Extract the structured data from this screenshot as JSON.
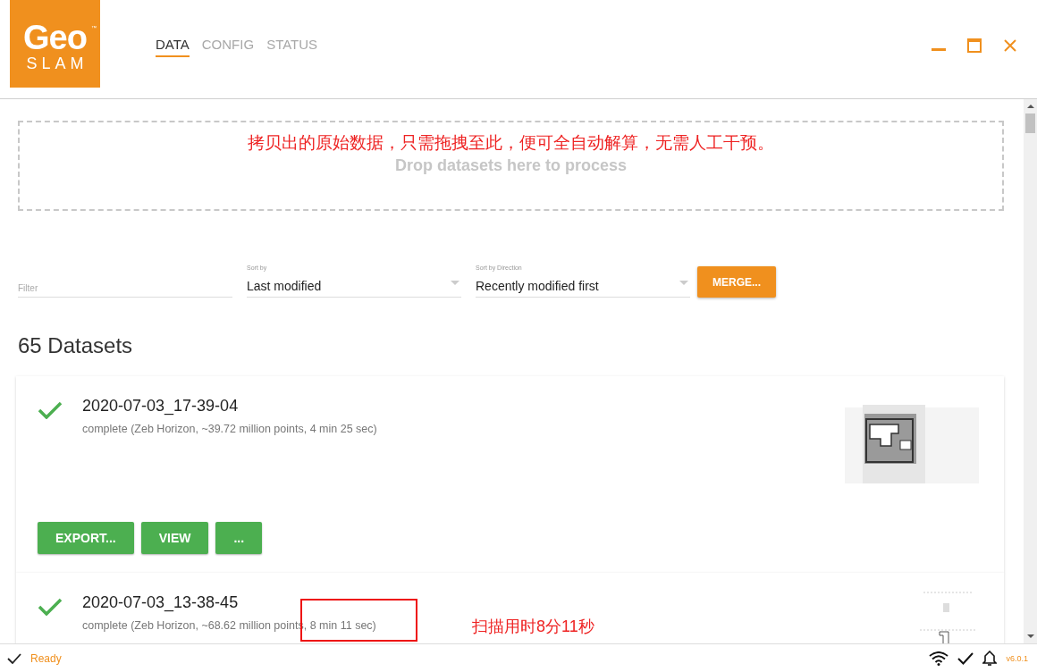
{
  "logo": {
    "word": "Geo",
    "subword": "SLAM",
    "trademark": "™"
  },
  "tabs": [
    {
      "label": "DATA",
      "selected": true
    },
    {
      "label": "CONFIG",
      "selected": false
    },
    {
      "label": "STATUS",
      "selected": false
    }
  ],
  "drop_zone": {
    "annotation": "拷贝出的原始数据，只需拖拽至此，便可全自动解算，无需人工干预。",
    "hint": "Drop datasets here to process"
  },
  "filter": {
    "placeholder": "Filter"
  },
  "sort_by": {
    "label": "Sort by",
    "value": "Last modified"
  },
  "sort_direction": {
    "label": "Sort by Direction",
    "value": "Recently modified first"
  },
  "merge_button": "MERGE...",
  "dataset_count": "65 Datasets",
  "datasets": [
    {
      "name": "2020-07-03_17-39-04",
      "details": "complete (Zeb Horizon, ~39.72 million points, 4 min 25 sec)",
      "complete": true,
      "expanded": true,
      "buttons": [
        "EXPORT...",
        "VIEW",
        "..."
      ]
    },
    {
      "name": "2020-07-03_13-38-45",
      "details": "complete (Zeb Horizon, ~68.62 million points, 8 min 11 sec)",
      "complete": true,
      "expanded": false,
      "annotation": {
        "note": "扫描用时8分11秒"
      }
    }
  ],
  "status_bar": {
    "status": "Ready",
    "version": "v6.0.1"
  }
}
